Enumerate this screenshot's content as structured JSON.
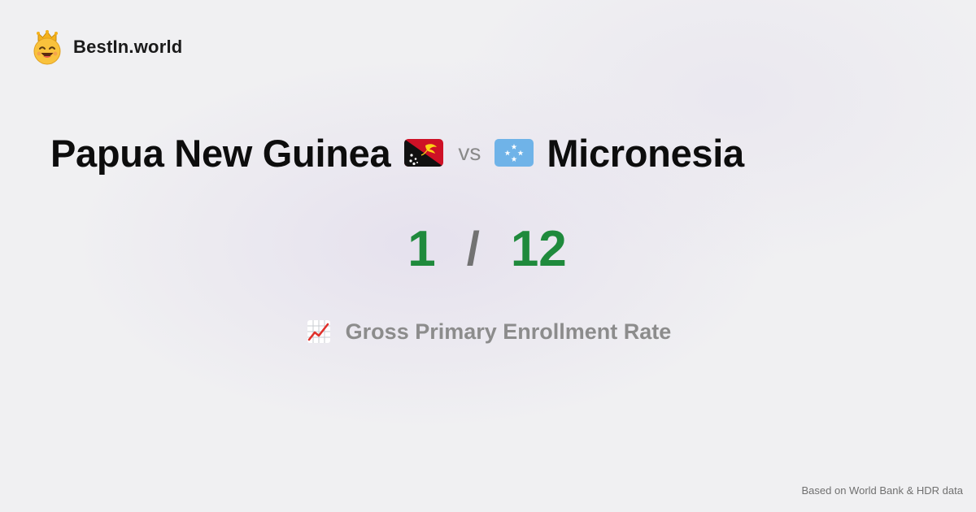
{
  "brand": {
    "name": "BestIn.world",
    "logo_icon": "smiling-crown-face-icon"
  },
  "comparison": {
    "left_country": "Papua New Guinea",
    "left_flag_icon": "papua-new-guinea-flag-icon",
    "vs_label": "vs",
    "right_flag_icon": "micronesia-flag-icon",
    "right_country": "Micronesia"
  },
  "score": {
    "left_rank": "1",
    "separator": "/",
    "right_rank": "12",
    "rank_color": "#1f8a3c"
  },
  "metric": {
    "icon": "chart-increasing-icon",
    "label": "Gross Primary Enrollment Rate"
  },
  "footer": {
    "source_note": "Based on World Bank & HDR data"
  },
  "colors": {
    "background": "#f0f0f2",
    "title_text": "#0d0d0d",
    "muted_text": "#8c8c8c"
  }
}
